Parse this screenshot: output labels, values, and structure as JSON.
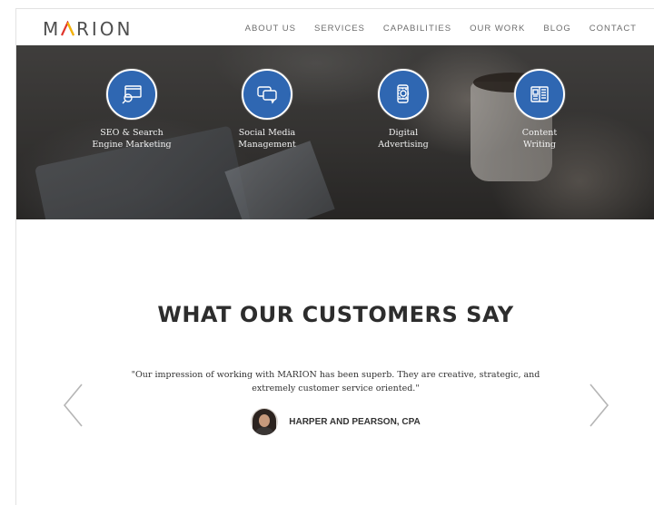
{
  "header": {
    "logo_text": "MARION",
    "nav": [
      "ABOUT US",
      "SERVICES",
      "CAPABILITIES",
      "OUR WORK",
      "BLOG",
      "CONTACT"
    ]
  },
  "services": [
    {
      "line1": "SEO & Search",
      "line2": "Engine Marketing",
      "icon": "monitor-search-icon"
    },
    {
      "line1": "Social Media",
      "line2": "Management",
      "icon": "chat-bubbles-icon"
    },
    {
      "line1": "Digital",
      "line2": "Advertising",
      "icon": "mobile-touch-icon"
    },
    {
      "line1": "Content",
      "line2": "Writing",
      "icon": "document-icon"
    }
  ],
  "testimonials": {
    "heading": "WHAT OUR CUSTOMERS SAY",
    "quote_line1": "\"Our impression of working with MARION has been superb. They are creative, strategic, and",
    "quote_line2": "extremely customer service oriented.\"",
    "author": "HARPER AND PEARSON, CPA"
  },
  "colors": {
    "accent_blue": "#2f67b2",
    "logo_a_colors": [
      "#e0362c",
      "#f2b705"
    ]
  }
}
